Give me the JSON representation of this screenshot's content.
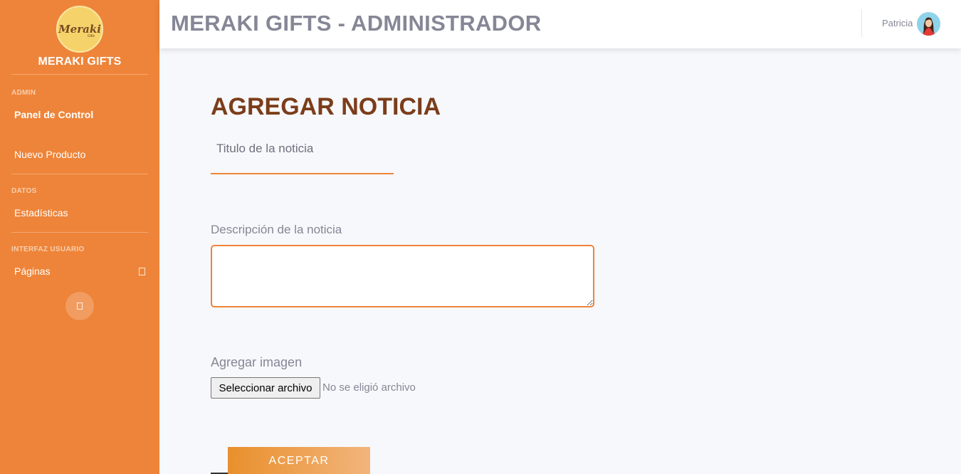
{
  "sidebar": {
    "logo_text": "Meraki",
    "logo_subtext": "Gifts",
    "brand_name": "MERAKI GIFTS",
    "sections": [
      {
        "label": "ADMIN",
        "items": [
          {
            "label": "Panel de Control",
            "active": true
          },
          {
            "label": "Nuevo Producto"
          }
        ]
      },
      {
        "label": "DATOS",
        "items": [
          {
            "label": "Estadísticas"
          }
        ]
      },
      {
        "label": "INTERFAZ USUARIO",
        "items": [
          {
            "label": "Páginas",
            "has_caret": true
          }
        ]
      }
    ]
  },
  "topbar": {
    "title": "MERAKI GIFTS - ADMINISTRADOR",
    "user_name": "Patricia"
  },
  "form": {
    "page_title": "AGREGAR NOTICIA",
    "title_placeholder": "Titulo de la noticia",
    "description_label": "Descripción de la noticia",
    "description_value": "",
    "image_label": "Agregar imagen",
    "file_button_label": "Seleccionar archivo",
    "file_status": "No se eligió archivo",
    "accept_label": "ACEPTAR"
  },
  "colors": {
    "sidebar": "#ee8439",
    "title": "#7b3d1a",
    "accent": "#ee8439"
  }
}
